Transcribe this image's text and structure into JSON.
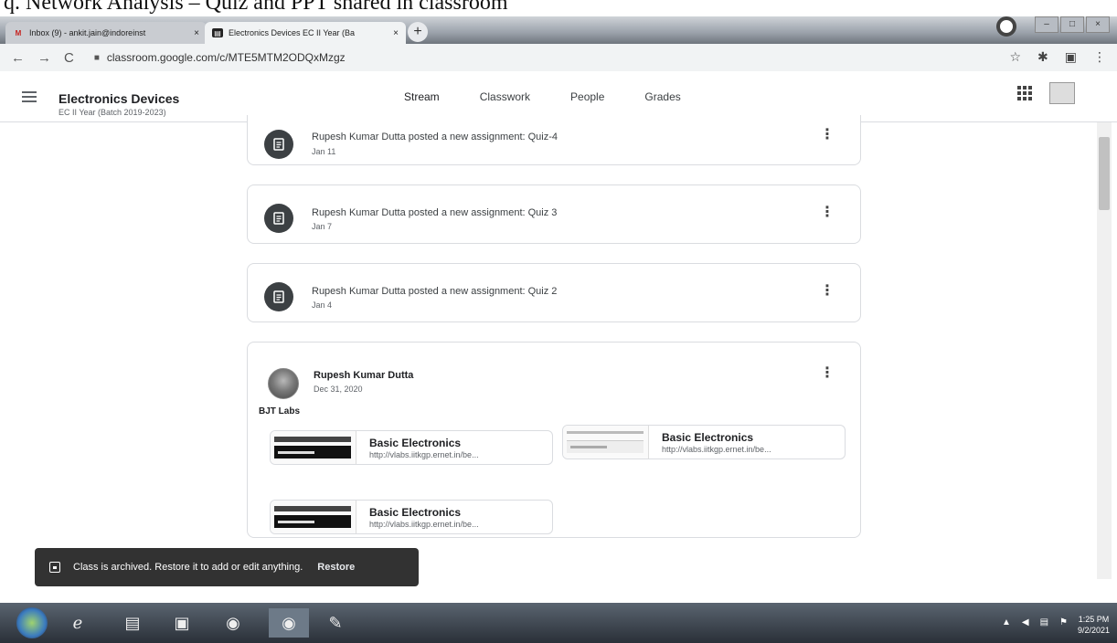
{
  "caption": "q.  Network Analysis – Quiz and PPT shared in classroom",
  "browser": {
    "tabs": [
      {
        "label": "Inbox (9) - ankit.jain@indoreinst",
        "close": "×"
      },
      {
        "label": "Electronics Devices EC II Year (Ba",
        "close": "×"
      }
    ],
    "new_tab": "+",
    "url": "classroom.google.com/c/MTE5MTM2ODQxMzgz"
  },
  "header": {
    "class_title": "Electronics Devices",
    "class_subtitle": "EC II Year (Batch 2019-2023)",
    "tabs": [
      "Stream",
      "Classwork",
      "People",
      "Grades"
    ],
    "active_tab": "Stream"
  },
  "stream": [
    {
      "text": "Rupesh Kumar Dutta posted a new assignment: Quiz-4",
      "date": "Jan 11"
    },
    {
      "text": "Rupesh Kumar Dutta posted a new assignment: Quiz 3",
      "date": "Jan 7"
    },
    {
      "text": "Rupesh Kumar Dutta posted a new assignment: Quiz 2",
      "date": "Jan 4"
    }
  ],
  "post": {
    "author": "Rupesh Kumar Dutta",
    "date": "Dec 31, 2020",
    "body": "BJT Labs",
    "attachments": [
      {
        "title": "Basic Electronics",
        "url": "http://vlabs.iitkgp.ernet.in/be..."
      },
      {
        "title": "Basic Electronics",
        "url": "http://vlabs.iitkgp.ernet.in/be..."
      },
      {
        "title": "Basic Electronics",
        "url": "http://vlabs.iitkgp.ernet.in/be..."
      }
    ]
  },
  "snackbar": {
    "message": "Class is archived. Restore it to add or edit anything.",
    "action": "Restore"
  },
  "taskbar": {
    "time": "1:25 PM",
    "date": "9/2/2021"
  },
  "colors": {
    "accent": "#202124",
    "snackbar_bg": "#323232",
    "assignment_icon_bg": "#3c4043"
  }
}
